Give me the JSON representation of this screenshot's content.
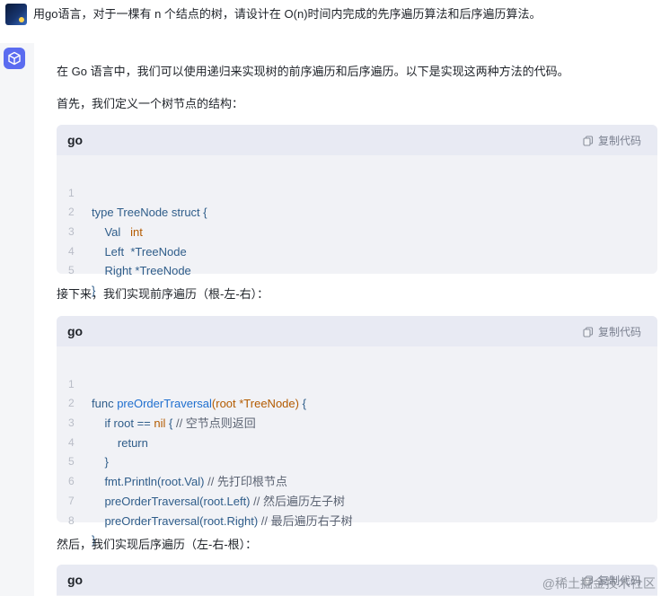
{
  "user_message": {
    "text": "用go语言，对于一棵有 n 个结点的树，请设计在 O(n)时间内完成的先序遍历算法和后序遍历算法。"
  },
  "assistant": {
    "intro": "在 Go 语言中，我们可以使用递归来实现树的前序遍历和后序遍历。以下是实现这两种方法的代码。",
    "p1": "首先，我们定义一个树节点的结构：",
    "p2": "接下来，我们实现前序遍历（根-左-右）：",
    "p3": "然后，我们实现后序遍历（左-右-根）：",
    "copy_label": "复制代码",
    "blocks": [
      {
        "lang": "go",
        "lines": [
          {
            "n": "1",
            "text": "type TreeNode struct {"
          },
          {
            "n": "2",
            "text": "    Val   int"
          },
          {
            "n": "3",
            "text": "    Left  *TreeNode"
          },
          {
            "n": "4",
            "text": "    Right *TreeNode"
          },
          {
            "n": "5",
            "text": "}"
          }
        ]
      },
      {
        "lang": "go",
        "lines": [
          {
            "n": "1",
            "text": "func preOrderTraversal(root *TreeNode) {"
          },
          {
            "n": "2",
            "text": "    if root == nil { // 空节点则返回"
          },
          {
            "n": "3",
            "text": "        return"
          },
          {
            "n": "4",
            "text": "    }"
          },
          {
            "n": "5",
            "text": "    fmt.Println(root.Val) // 先打印根节点"
          },
          {
            "n": "6",
            "text": "    preOrderTraversal(root.Left) // 然后遍历左子树"
          },
          {
            "n": "7",
            "text": "    preOrderTraversal(root.Right) // 最后遍历右子树"
          },
          {
            "n": "8",
            "text": "}"
          }
        ]
      },
      {
        "lang": "go",
        "lines": []
      }
    ]
  },
  "watermark": "@稀土掘金技术社区",
  "colors": {
    "code_bg": "#f1f2f6",
    "code_header_bg": "#e8eaf3",
    "keyword": "#2f5d8a",
    "type": "#b35b00",
    "function": "#1f6fcf",
    "ai_accent": "#5b6cf0"
  },
  "icons": {
    "user_avatar": "user-avatar-image",
    "ai_avatar": "cube-icon",
    "copy": "copy-icon"
  }
}
